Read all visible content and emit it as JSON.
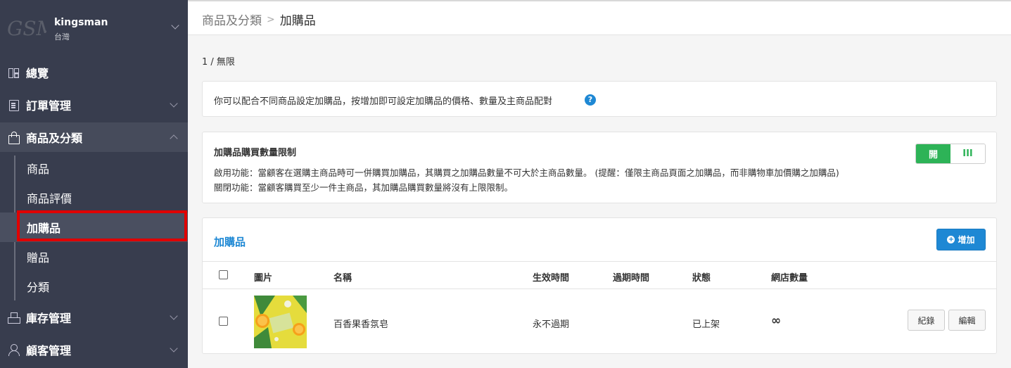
{
  "brand": {
    "logo": "GSM",
    "name": "kingsman",
    "region": "台灣"
  },
  "nav": {
    "overview": "總覽",
    "orders": "訂單管理",
    "products": "商品及分類",
    "inventory": "庫存管理",
    "customers": "顧客管理"
  },
  "subnav": {
    "items": [
      "商品",
      "商品評價",
      "加購品",
      "贈品",
      "分類"
    ]
  },
  "breadcrumb": {
    "parent": "商品及分類",
    "separator": ">",
    "current": "加購品"
  },
  "page_count": "1 / 無限",
  "info": {
    "text": "你可以配合不同商品設定加購品，按增加即可設定加購品的價格、數量及主商品配對",
    "help": "?"
  },
  "limit": {
    "title": "加購品購買數量限制",
    "on_text": "啟用功能：當顧客在選購主商品時可一併購買加購品，其購買之加購品數量不可大於主商品數量。 (提醒：僅限主商品頁面之加購品，而非購物車加價購之加購品)",
    "off_text": "關閉功能：當顧客購買至少一件主商品，其加購品購買數量將沒有上限限制。",
    "toggle_on": "開",
    "toggle_off": "III",
    "state": "on"
  },
  "list": {
    "title": "加購品",
    "add_button": "增加",
    "columns": {
      "image": "圖片",
      "name": "名稱",
      "start": "生效時間",
      "end": "過期時間",
      "status": "狀態",
      "stores": "網店數量"
    },
    "rows": [
      {
        "name": "百香果香氛皂",
        "start": "永不過期",
        "end": "",
        "status": "已上架",
        "stores": "∞",
        "log_button": "紀錄",
        "edit_button": "編輯"
      }
    ]
  },
  "colors": {
    "sidebar": "#383d4e",
    "accent": "#1e88d4",
    "toggle_on": "#2db357",
    "highlight": "#e00000"
  }
}
